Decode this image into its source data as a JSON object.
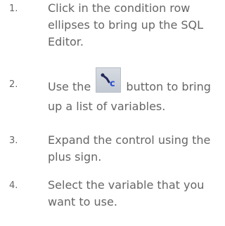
{
  "steps": [
    {
      "number": "1.",
      "lines": [
        "Click in the condition row",
        "ellipses to bring up the SQL",
        "Editor."
      ]
    },
    {
      "number": "2.",
      "before_icon": "Use the",
      "icon": "variables-button-icon",
      "after_icon": "button to bring",
      "lines_after": [
        "up a list of variables."
      ]
    },
    {
      "number": "3.",
      "lines": [
        "Expand the control using the",
        "plus sign."
      ]
    },
    {
      "number": "4.",
      "lines": [
        "Select the variable that you",
        "want to use."
      ]
    }
  ],
  "colors": {
    "text": "#666666",
    "icon_background": "#c9ced6",
    "icon_blue": "#2a4bd6",
    "icon_dark": "#22285a"
  }
}
